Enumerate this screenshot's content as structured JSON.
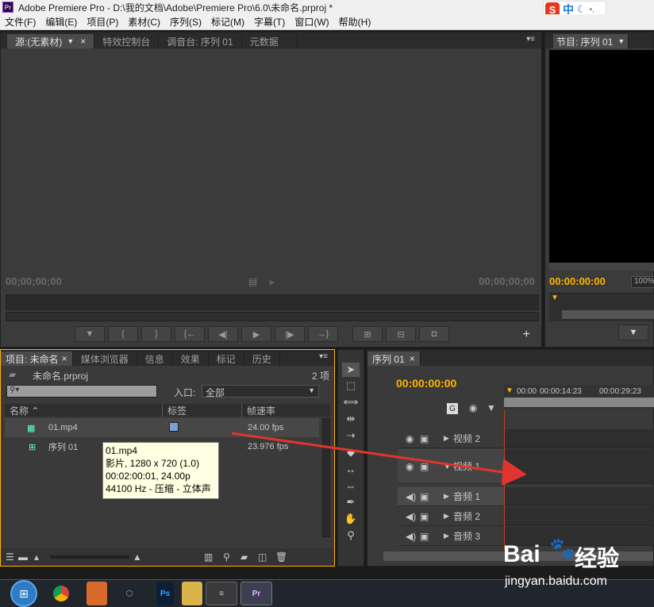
{
  "window": {
    "title": "Adobe Premiere Pro - D:\\我的文档\\Adobe\\Premiere Pro\\6.0\\未命名.prproj *"
  },
  "ime": {
    "lang": "中"
  },
  "menu": [
    "文件(F)",
    "编辑(E)",
    "项目(P)",
    "素材(C)",
    "序列(S)",
    "标记(M)",
    "字幕(T)",
    "窗口(W)",
    "帮助(H)"
  ],
  "source_monitor": {
    "tabs": [
      "源:(无素材)",
      "特效控制台",
      "调音台: 序列 01",
      "元数据"
    ],
    "timecode_left": "00;00;00;00",
    "timecode_right": "00;00;00;00"
  },
  "program_monitor": {
    "tab": "节目: 序列 01",
    "timecode": "00:00:00:00",
    "zoom": "100%"
  },
  "project_panel": {
    "tabs": [
      "项目: 未命名",
      "媒体浏览器",
      "信息",
      "效果",
      "标记",
      "历史"
    ],
    "file_name": "未命名.prproj",
    "item_count": "2 项",
    "in_label": "入口:",
    "in_value": "全部",
    "columns": [
      "名称",
      "标签",
      "帧速率"
    ],
    "items": [
      {
        "name": "01.mp4",
        "fps": "24.00 fps",
        "label_color": "#7c9fd6"
      },
      {
        "name": "序列 01",
        "fps": "23.976 fps",
        "label_color": "#1a1a1a"
      }
    ]
  },
  "tooltip": {
    "lines": [
      "01.mp4",
      "影片, 1280 x 720 (1.0)",
      "00:02:00:01, 24.00p",
      "44100 Hz - 压缩 - 立体声"
    ]
  },
  "timeline": {
    "tab": "序列 01",
    "timecode": "00:00:00:00",
    "ruler": [
      "00:00",
      "00:00:14:23",
      "00:00:29:23"
    ],
    "tracks": [
      "视频 2",
      "视频 1",
      "音频 1",
      "音频 2",
      "音频 3"
    ]
  },
  "watermark": {
    "brand": "Bai",
    "brand2": "经验",
    "url": "jingyan.baidu.com"
  },
  "colors": {
    "accent": "#ffb400",
    "arrow": "#e0352f"
  }
}
